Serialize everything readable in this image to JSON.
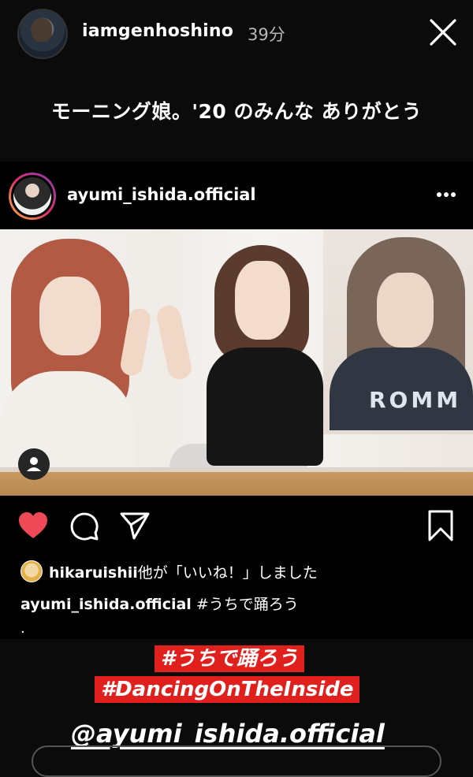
{
  "story": {
    "username": "iamgenhoshino",
    "time": "39分",
    "caption": "モーニング娘。'20 のみんな ありがとう"
  },
  "post": {
    "username": "ayumi_ishida.official",
    "photo_shirt_text": "ROMM",
    "likes_user": "hikaruishii",
    "likes_suffix": "他が「いいね！」しました",
    "caption_user": "ayumi_ishida.official",
    "caption_text": " #うちで踊ろう",
    "caption_more": "."
  },
  "stickers": {
    "hashtag_jp": "#うちで踊ろう",
    "hashtag_en": "#DancingOnTheInside",
    "mention": "@ayumi_ishida.official"
  },
  "colors": {
    "background": "#0b0b0b",
    "heart": "#ed4956",
    "tag_red": "#e0201d"
  },
  "icons": [
    "close-icon",
    "more-icon",
    "user-tag-icon",
    "heart-icon",
    "comment-icon",
    "share-icon",
    "bookmark-icon"
  ]
}
